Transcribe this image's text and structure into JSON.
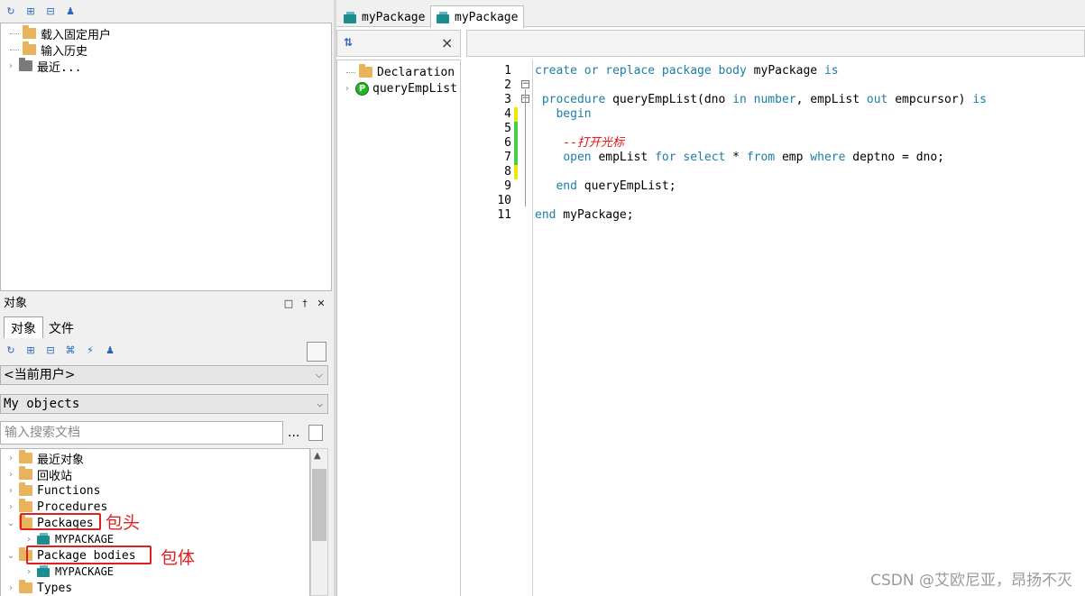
{
  "history_panel": {
    "items": [
      {
        "label": "载入固定用户",
        "expandable": false
      },
      {
        "label": "输入历史",
        "expandable": false
      },
      {
        "label": "最近...",
        "expandable": true
      }
    ]
  },
  "objects_panel": {
    "title": "对象",
    "tabs": [
      {
        "label": "对象"
      },
      {
        "label": "文件"
      }
    ],
    "user_select": "<当前用户>",
    "filter_select": "My objects",
    "search_placeholder": "输入搜索文档",
    "search_more": "...",
    "tree": [
      {
        "label": "最近对象"
      },
      {
        "label": "回收站"
      },
      {
        "label": "Functions"
      },
      {
        "label": "Procedures"
      },
      {
        "label": "Packages"
      },
      {
        "label": "MYPACKAGE"
      },
      {
        "label": "Package bodies"
      },
      {
        "label": "MYPACKAGE"
      },
      {
        "label": "Types"
      }
    ],
    "annotations": {
      "package_spec": "包头",
      "package_body": "包体"
    }
  },
  "editor": {
    "tabs": [
      {
        "label": "myPackage"
      },
      {
        "label": "myPackage"
      }
    ],
    "structure": [
      {
        "label": "Declaration"
      },
      {
        "label": "queryEmpList"
      }
    ],
    "structure_close": "×",
    "line_numbers": [
      "1",
      "2",
      "3",
      "4",
      "5",
      "6",
      "7",
      "8",
      "9",
      "10",
      "11"
    ],
    "code": {
      "l1": {
        "a": "create",
        "b": " ",
        "c": "or",
        "d": " ",
        "e": "replace",
        "f": " ",
        "g": "package",
        "h": " ",
        "i": "body",
        "j": " myPackage ",
        "k": "is"
      },
      "l3": {
        "a": " ",
        "b": "procedure",
        "c": " queryEmpList(dno ",
        "d": "in",
        "e": " ",
        "f": "number",
        "g": ", empList ",
        "h": "out",
        "i": " empcursor) ",
        "j": "is"
      },
      "l4": {
        "a": "   ",
        "b": "begin"
      },
      "l6": {
        "a": "    ",
        "b": "--打开光标"
      },
      "l7": {
        "a": "    ",
        "b": "open",
        "c": " empList ",
        "d": "for",
        "e": " ",
        "f": "select",
        "g": " * ",
        "h": "from",
        "i": " emp ",
        "j": "where",
        "k": " deptno = dno;"
      },
      "l9": {
        "a": "   ",
        "b": "end",
        "c": " queryEmpList;"
      },
      "l11": {
        "a": "end",
        "b": " myPackage;"
      }
    }
  },
  "watermark": "CSDN @艾欧尼亚，昂扬不灭"
}
